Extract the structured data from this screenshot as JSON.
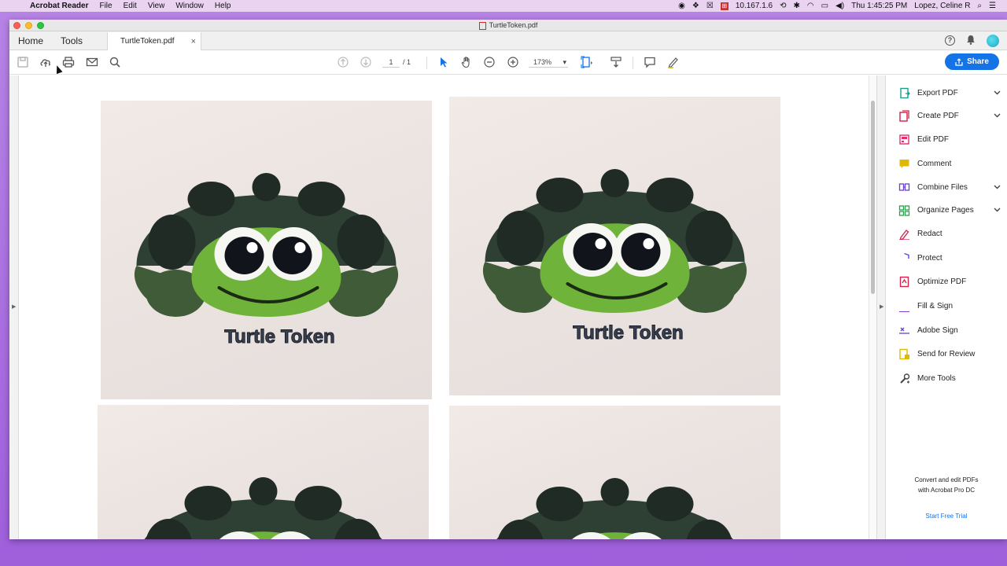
{
  "menubar": {
    "app_name": "Acrobat Reader",
    "menus": [
      "File",
      "Edit",
      "View",
      "Window",
      "Help"
    ],
    "ip_address": "10.167.1.6",
    "clock": "Thu 1:45:25 PM",
    "user": "Lopez, Celine R"
  },
  "window": {
    "title": "TurtleToken.pdf"
  },
  "tabs": {
    "home": "Home",
    "tools": "Tools",
    "document": "TurtleToken.pdf",
    "close": "×"
  },
  "toolbar": {
    "page_current": "1",
    "page_total": "/ 1",
    "zoom": "173%",
    "share_label": "Share"
  },
  "document": {
    "token_caption": "Turtle Token"
  },
  "tools_panel": {
    "items": [
      {
        "label": "Export PDF",
        "icon": "export-pdf-icon",
        "color": "#1a9e8a",
        "expandable": true
      },
      {
        "label": "Create PDF",
        "icon": "create-pdf-icon",
        "color": "#d4204a",
        "expandable": true
      },
      {
        "label": "Edit PDF",
        "icon": "edit-pdf-icon",
        "color": "#e0306a",
        "expandable": false
      },
      {
        "label": "Comment",
        "icon": "comment-icon",
        "color": "#e0b800",
        "expandable": false
      },
      {
        "label": "Combine Files",
        "icon": "combine-files-icon",
        "color": "#6a3fd4",
        "expandable": true
      },
      {
        "label": "Organize Pages",
        "icon": "organize-pages-icon",
        "color": "#2aa04a",
        "expandable": true
      },
      {
        "label": "Redact",
        "icon": "redact-icon",
        "color": "#d4204a",
        "expandable": false
      },
      {
        "label": "Protect",
        "icon": "protect-icon",
        "color": "#6a3fd4",
        "expandable": false
      },
      {
        "label": "Optimize PDF",
        "icon": "optimize-pdf-icon",
        "color": "#d4204a",
        "expandable": false
      },
      {
        "label": "Fill & Sign",
        "icon": "fill-sign-icon",
        "color": "#8a3fd4",
        "expandable": false
      },
      {
        "label": "Adobe Sign",
        "icon": "adobe-sign-icon",
        "color": "#6a3fd4",
        "expandable": false
      },
      {
        "label": "Send for Review",
        "icon": "send-for-review-icon",
        "color": "#e0b800",
        "expandable": false
      },
      {
        "label": "More Tools",
        "icon": "more-tools-icon",
        "color": "#444444",
        "expandable": false
      }
    ],
    "promo_line1": "Convert and edit PDFs",
    "promo_line2": "with Acrobat Pro DC",
    "trial_link": "Start Free Trial"
  },
  "colors": {
    "accent": "#1473e6",
    "desktop": "#a96ae0"
  }
}
